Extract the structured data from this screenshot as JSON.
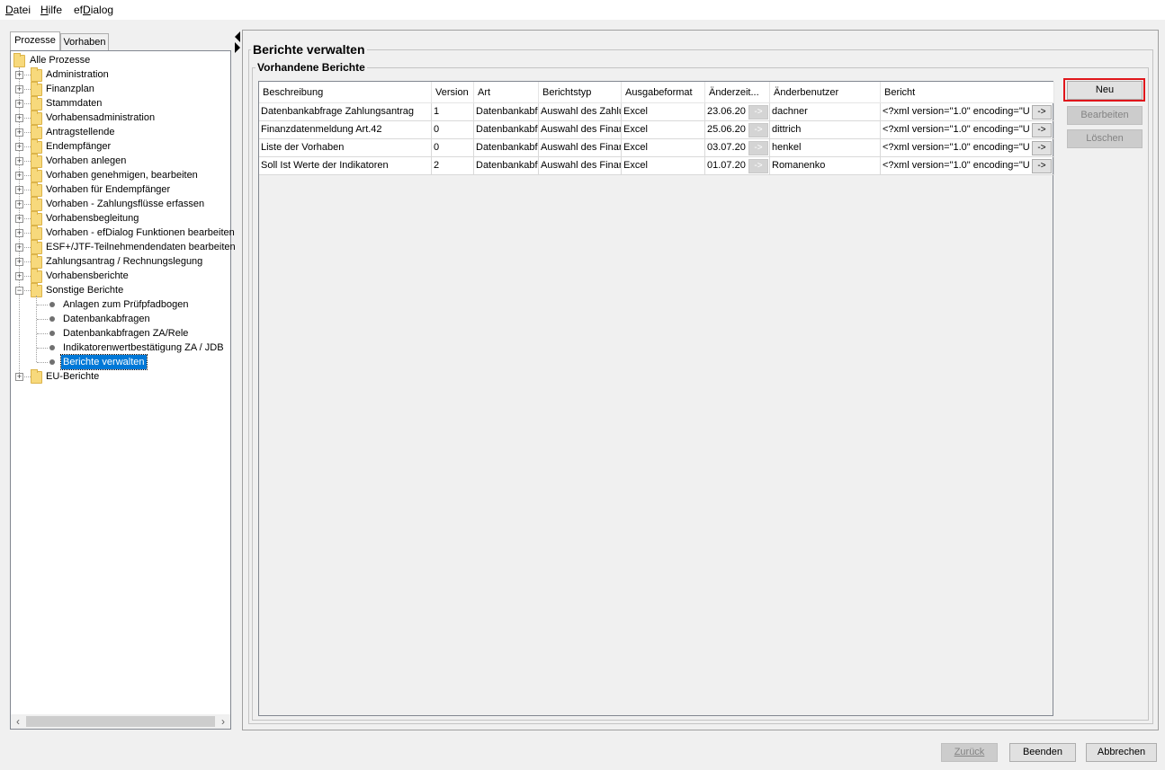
{
  "menubar": {
    "items": [
      {
        "label": "Datei",
        "accel": "D",
        "rest": "atei"
      },
      {
        "label": "Hilfe",
        "accel": "H",
        "rest": "ilfe"
      },
      {
        "label": "efDialog",
        "pre": "ef",
        "accel": "D",
        "rest": "ialog"
      }
    ]
  },
  "tabs": {
    "prozesse": "Prozesse",
    "vorhaben": "Vorhaben"
  },
  "tree": {
    "root": "Alle Prozesse",
    "items": [
      "Administration",
      "Finanzplan",
      "Stammdaten",
      "Vorhabensadministration",
      "Antragstellende",
      "Endempfänger",
      "Vorhaben anlegen",
      "Vorhaben genehmigen, bearbeiten",
      "Vorhaben für Endempfänger",
      "Vorhaben - Zahlungsflüsse erfassen",
      "Vorhabensbegleitung",
      "Vorhaben - efDialog Funktionen bearbeiten",
      "ESF+/JTF-Teilnehmendendaten bearbeiten",
      "Zahlungsantrag / Rechnungslegung",
      "Vorhabensberichte",
      "Sonstige Berichte"
    ],
    "children": [
      "Anlagen zum Prüfpfadbogen",
      "Datenbankabfragen",
      "Datenbankabfragen ZA/Rele",
      "Indikatorenwertbestätigung ZA / JDB",
      "Berichte verwalten"
    ],
    "last": "EU-Berichte"
  },
  "main": {
    "title": "Berichte verwalten",
    "group_title": "Vorhandene Berichte",
    "columns": [
      "Beschreibung",
      "Version",
      "Art",
      "Berichtstyp",
      "Ausgabeformat",
      "Änderzeit...",
      "Änderbenutzer",
      "Bericht"
    ],
    "rows": [
      [
        "Datenbankabfrage Zahlungsantrag",
        "1",
        "Datenbankabfr",
        "Auswahl des Zahlu",
        "Excel",
        "23.06.20",
        "dachner",
        "<?xml version=\"1.0\" encoding=\"U"
      ],
      [
        "Finanzdatenmeldung Art.42",
        "0",
        "Datenbankabfr",
        "Auswahl des Finan",
        "Excel",
        "25.06.20",
        "dittrich",
        "<?xml version=\"1.0\" encoding=\"U"
      ],
      [
        "Liste der Vorhaben",
        "0",
        "Datenbankabfr",
        "Auswahl des Finan",
        "Excel",
        "03.07.20",
        "henkel",
        "<?xml version=\"1.0\" encoding=\"U"
      ],
      [
        "Soll Ist Werte der Indikatoren",
        "2",
        "Datenbankabfr",
        "Auswahl des Finan",
        "Excel",
        "01.07.20",
        "Romanenko",
        "<?xml version=\"1.0\" encoding=\"U"
      ]
    ],
    "cell_button": "->",
    "buttons": {
      "neu": "Neu",
      "bearbeiten": "Bearbeiten",
      "loeschen": "Löschen"
    }
  },
  "footer": {
    "zurueck": "Zurück",
    "beenden": "Beenden",
    "abbrechen": "Abbrechen"
  },
  "colors": {
    "selection": "#0078d7",
    "highlight": "#e0161b"
  }
}
